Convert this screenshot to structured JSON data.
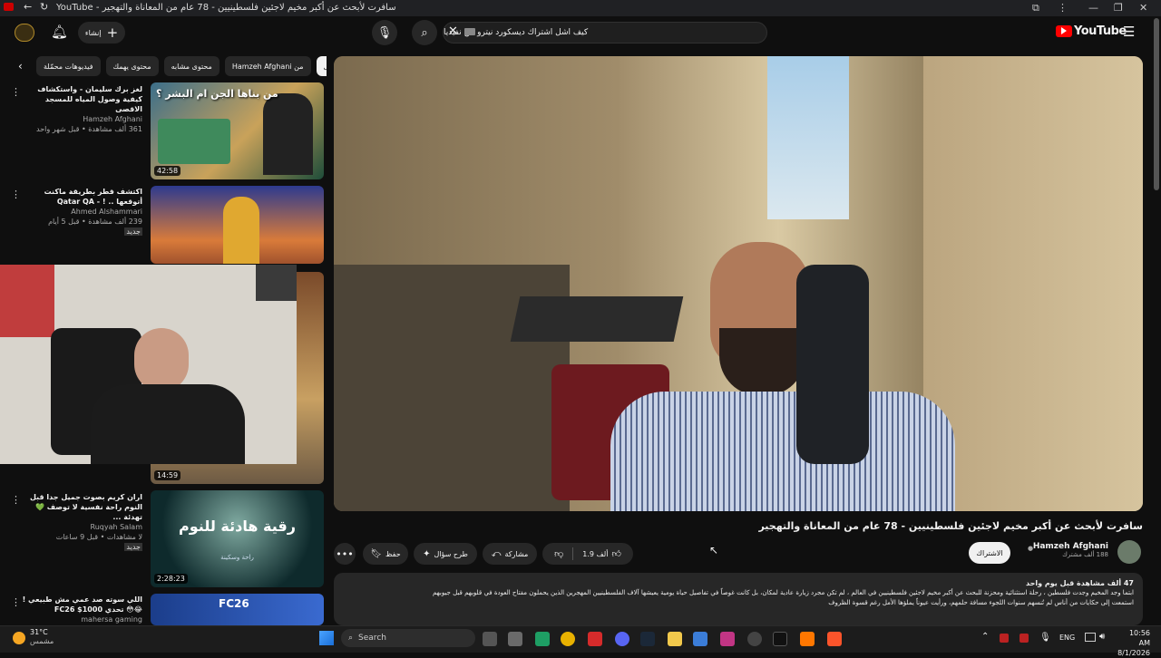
{
  "browser": {
    "tab_title": "YouTube - سافرت لأبحث عن أكبر مخيم لاجئين فلسطينيين - 78 عام من المعاناة والتهجير",
    "controls": [
      "—",
      "❐",
      "✕"
    ]
  },
  "header": {
    "logo": "YouTube",
    "search_value": "كيف اشل اشتراك ديسكورد نيترو من نفيديا",
    "create_label": "إنشاء"
  },
  "chips": [
    "الكل",
    "من Hamzeh Afghani",
    "محتوى مشابه",
    "محتوى يهمك",
    "فيديوهات محمّلة"
  ],
  "recommendations": [
    {
      "title": "لغز برك سليمان - واستكشاف كيفية وصول المياه للمسجد الاقصى",
      "channel": "Hamzeh Afghani",
      "meta": "361 ألف مشاهدة • قبل شهر واحد",
      "duration": "42:58",
      "thumb_text": "من بناها الجن ام البشر ؟"
    },
    {
      "title": "اكتشف قطر بطريقة ماكنت أتوقعها .. ! - Qatar QA",
      "channel": "Ahmed Alshammari",
      "meta": "239 ألف مشاهدة • قبل 5 أيام",
      "badge": "جديد",
      "duration": ""
    },
    {
      "title": "",
      "channel": "",
      "meta": "",
      "duration": "14:59"
    },
    {
      "title": "اران كريم بصوت جميل جدا قبل النوم راحة نفسية لا توصف 💚 تهدئة ...",
      "channel": "Ruqyah Salam",
      "meta": "لا مشاهدات • قبل 9 ساعات",
      "badge": "جديد",
      "duration": "2:28:23",
      "thumb_text": "رقية هادئة للنوم",
      "thumb_sub": "راحة وسكينة"
    },
    {
      "title": "اللي سوته صد عمي مش طبيعي ! 😂😳 تحدي FC26 $1000",
      "channel": "mahersa gaming",
      "meta": "",
      "duration": "",
      "thumb_text": "FC26"
    }
  ],
  "video": {
    "title": "سافرت لأبحث عن أكبر مخيم لاجئين فلسطينيين - 78 عام من المعاناة والتهجير",
    "channel": "Hamzeh Afghani",
    "subscribers": "188 ألف مشترك",
    "subscribe_label": "الاشتراك",
    "likes": "1.9 ألف",
    "share_label": "مشاركة",
    "ask_label": "طرح سؤال",
    "save_label": "حفظ",
    "views": "47 ألف مشاهدة  قبل يوم واحد",
    "desc_line1": "ابتما وجد المخيم وجدت فلسطين ، رحلة استثنائية ومحزنة للبحث عن أكبر مخيم لاجئين فلسطينيين في العالم ، لم تكن مجرد زيارة عادية لمكان، بل كانت غوصاً في تفاصيل حياة يومية يعيشها آلاف الفلسطينيين المهجرين الذين يحملون مفتاح العودة في قلوبهم قبل جيوبهم",
    "desc_line2": "استمعت إلى حكايات من أناس لم تُنسهم سنوات اللجوء مسافة حلمهم، ورأيت عيوناً يملؤها الأمل رغم قسوة الظروف"
  },
  "taskbar": {
    "weather_temp": "31°C",
    "weather_desc": "مشمس",
    "search_placeholder": "Search",
    "lang": "ENG",
    "time": "10:56 AM",
    "date": "8/1/2026"
  }
}
